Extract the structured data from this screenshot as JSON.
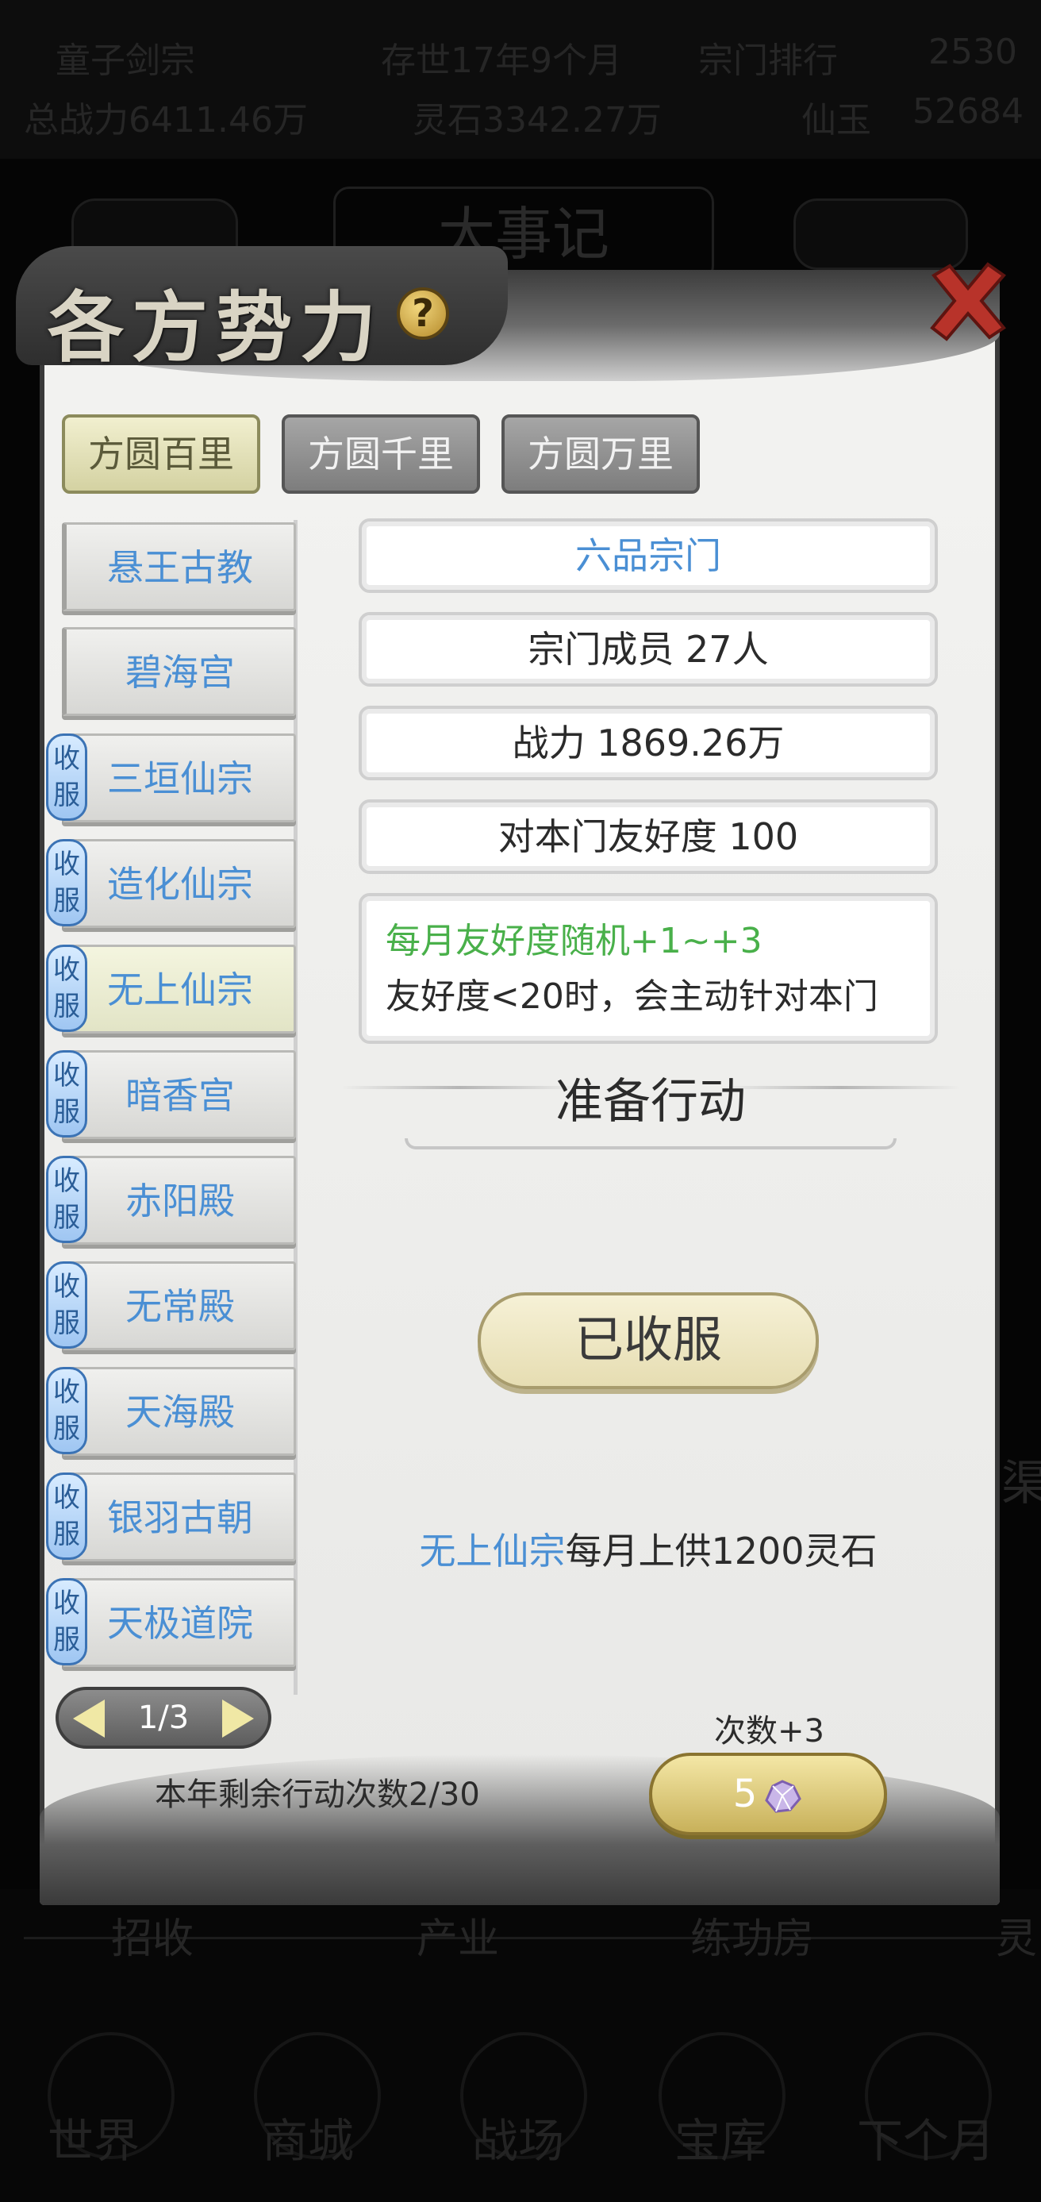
{
  "background": {
    "top_row1": [
      "童子剑宗",
      "存世17年9个月",
      "宗门排行",
      "2530"
    ],
    "top_row2": [
      "总战力6411.46万",
      "灵石3342.27万",
      "仙玉",
      "52684"
    ],
    "title_behind": "大事记",
    "nav_mid": [
      "招收",
      "产业",
      "练功房",
      "灵"
    ],
    "nav_bottom": [
      "世界",
      "商城",
      "战场",
      "宝库",
      "下个月"
    ],
    "side_glyph": "渠"
  },
  "dialog": {
    "title": "各方势力",
    "help_icon": "?",
    "close_icon": "close-icon"
  },
  "tabs": [
    {
      "label": "方圆百里",
      "active": true
    },
    {
      "label": "方圆千里",
      "active": false
    },
    {
      "label": "方圆万里",
      "active": false
    }
  ],
  "sects": [
    {
      "name": "悬王古教",
      "badge": ""
    },
    {
      "name": "碧海宫",
      "badge": ""
    },
    {
      "name": "三垣仙宗",
      "badge": "收服"
    },
    {
      "name": "造化仙宗",
      "badge": "收服"
    },
    {
      "name": "无上仙宗",
      "badge": "收服",
      "active": true
    },
    {
      "name": "暗香宫",
      "badge": "收服"
    },
    {
      "name": "赤阳殿",
      "badge": "收服"
    },
    {
      "name": "无常殿",
      "badge": "收服"
    },
    {
      "name": "天海殿",
      "badge": "收服"
    },
    {
      "name": "银羽古朝",
      "badge": "收服"
    },
    {
      "name": "天极道院",
      "badge": "收服"
    }
  ],
  "pager": {
    "text": "1/3"
  },
  "details": {
    "rank": "六品宗门",
    "members": "宗门成员 27人",
    "power": "战力 1869.26万",
    "friendship": "对本门友好度 100",
    "desc_line1": "每月友好度随机+1~+3",
    "desc_line2": "友好度<20时，会主动针对本门"
  },
  "section": {
    "title": "准备行动"
  },
  "status_button": {
    "label": "已收服"
  },
  "tribute": {
    "sect": "无上仙宗",
    "text": "每月上供1200灵石"
  },
  "footer": {
    "remaining": "本年剩余行动次数2/30",
    "plus_label": "次数+3",
    "cost": "5",
    "cost_icon": "spirit-gem-icon"
  }
}
